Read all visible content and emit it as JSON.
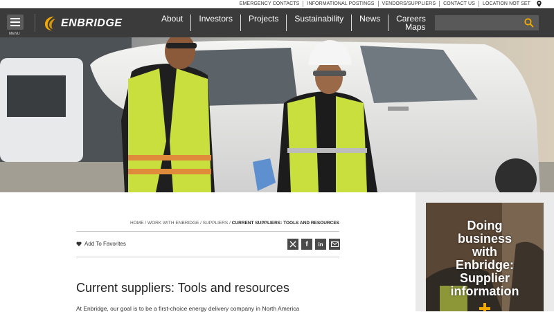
{
  "utility": {
    "links": [
      "EMERGENCY CONTACTS",
      "INFORMATIONAL POSTINGS",
      "VENDORS/SUPPLIERS",
      "CONTACT US",
      "LOCATION NOT SET"
    ]
  },
  "header": {
    "menu_label": "MENU",
    "logo_text": "ENBRIDGE",
    "nav": [
      "About",
      "Investors",
      "Projects",
      "Sustainability",
      "News"
    ],
    "careers_label": "Careers",
    "maps_label": "Maps",
    "search_placeholder": ""
  },
  "breadcrumb": {
    "items": [
      "HOME",
      "WORK WITH ENBRIDGE",
      "SUPPLIERS"
    ],
    "current": "CURRENT SUPPLIERS: TOOLS AND RESOURCES"
  },
  "actions": {
    "favorites_label": "Add To Favorites"
  },
  "main": {
    "title": "Current suppliers: Tools and resources",
    "intro": "At Enbridge, our goal is to be a first-choice energy delivery company in North America"
  },
  "promo": {
    "lines": [
      "Doing",
      "business",
      "with",
      "Enbridge:",
      "Supplier",
      "information"
    ]
  },
  "colors": {
    "header_bg": "#3b3b3b",
    "accent": "#f2a900",
    "sidebar_bg": "#eaeaea"
  }
}
